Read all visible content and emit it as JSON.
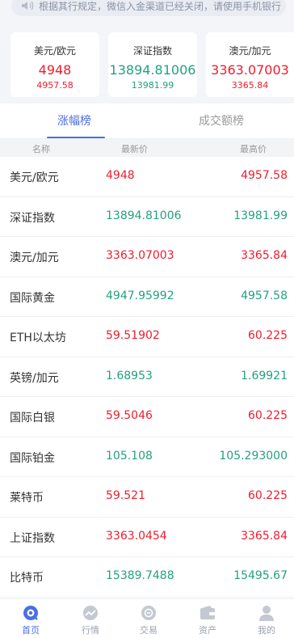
{
  "notice": {
    "text": "根据其行规定，微信入金渠道已经关闭，请使用手机银行"
  },
  "cards": [
    {
      "name": "美元/欧元",
      "price": "4948",
      "high": "4957.58",
      "color": "#ee1d2d"
    },
    {
      "name": "深证指数",
      "price": "13894.81006",
      "high": "13981.99",
      "color": "#23a17e"
    },
    {
      "name": "澳元/加元",
      "price": "3363.07003",
      "high": "3365.84",
      "color": "#ee1d2d"
    }
  ],
  "tabs": [
    {
      "label": "涨幅榜",
      "active": true
    },
    {
      "label": "成交额榜",
      "active": false
    }
  ],
  "columns": {
    "name": "名称",
    "latest": "最新价",
    "high": "最高价"
  },
  "rows": [
    {
      "name": "美元/欧元",
      "latest": "4948",
      "high": "4957.58",
      "trend": "up"
    },
    {
      "name": "深证指数",
      "latest": "13894.81006",
      "high": "13981.99",
      "trend": "down"
    },
    {
      "name": "澳元/加元",
      "latest": "3363.07003",
      "high": "3365.84",
      "trend": "up"
    },
    {
      "name": "国际黄金",
      "latest": "4947.95992",
      "high": "4957.58",
      "trend": "down"
    },
    {
      "name": "ETH以太坊",
      "latest": "59.51902",
      "high": "60.225",
      "trend": "up"
    },
    {
      "name": "英镑/加元",
      "latest": "1.68953",
      "high": "1.69921",
      "trend": "down"
    },
    {
      "name": "国际白银",
      "latest": "59.5046",
      "high": "60.225",
      "trend": "up"
    },
    {
      "name": "国际铂金",
      "latest": "105.108",
      "high": "105.293000",
      "trend": "down"
    },
    {
      "name": "莱特币",
      "latest": "59.521",
      "high": "60.225",
      "trend": "up"
    },
    {
      "name": "上证指数",
      "latest": "3363.0454",
      "high": "3365.84",
      "trend": "up"
    },
    {
      "name": "比特币",
      "latest": "15389.7488",
      "high": "15495.67",
      "trend": "down"
    }
  ],
  "tabbar": [
    {
      "label": "首页",
      "icon": "home-icon",
      "active": true
    },
    {
      "label": "行情",
      "icon": "market-icon",
      "active": false
    },
    {
      "label": "交易",
      "icon": "trade-icon",
      "active": false
    },
    {
      "label": "资产",
      "icon": "wallet-icon",
      "active": false
    },
    {
      "label": "我的",
      "icon": "user-icon",
      "active": false
    }
  ],
  "colors": {
    "up": "#ee1d2d",
    "down": "#23a17e",
    "accent": "#4b6fe3"
  }
}
